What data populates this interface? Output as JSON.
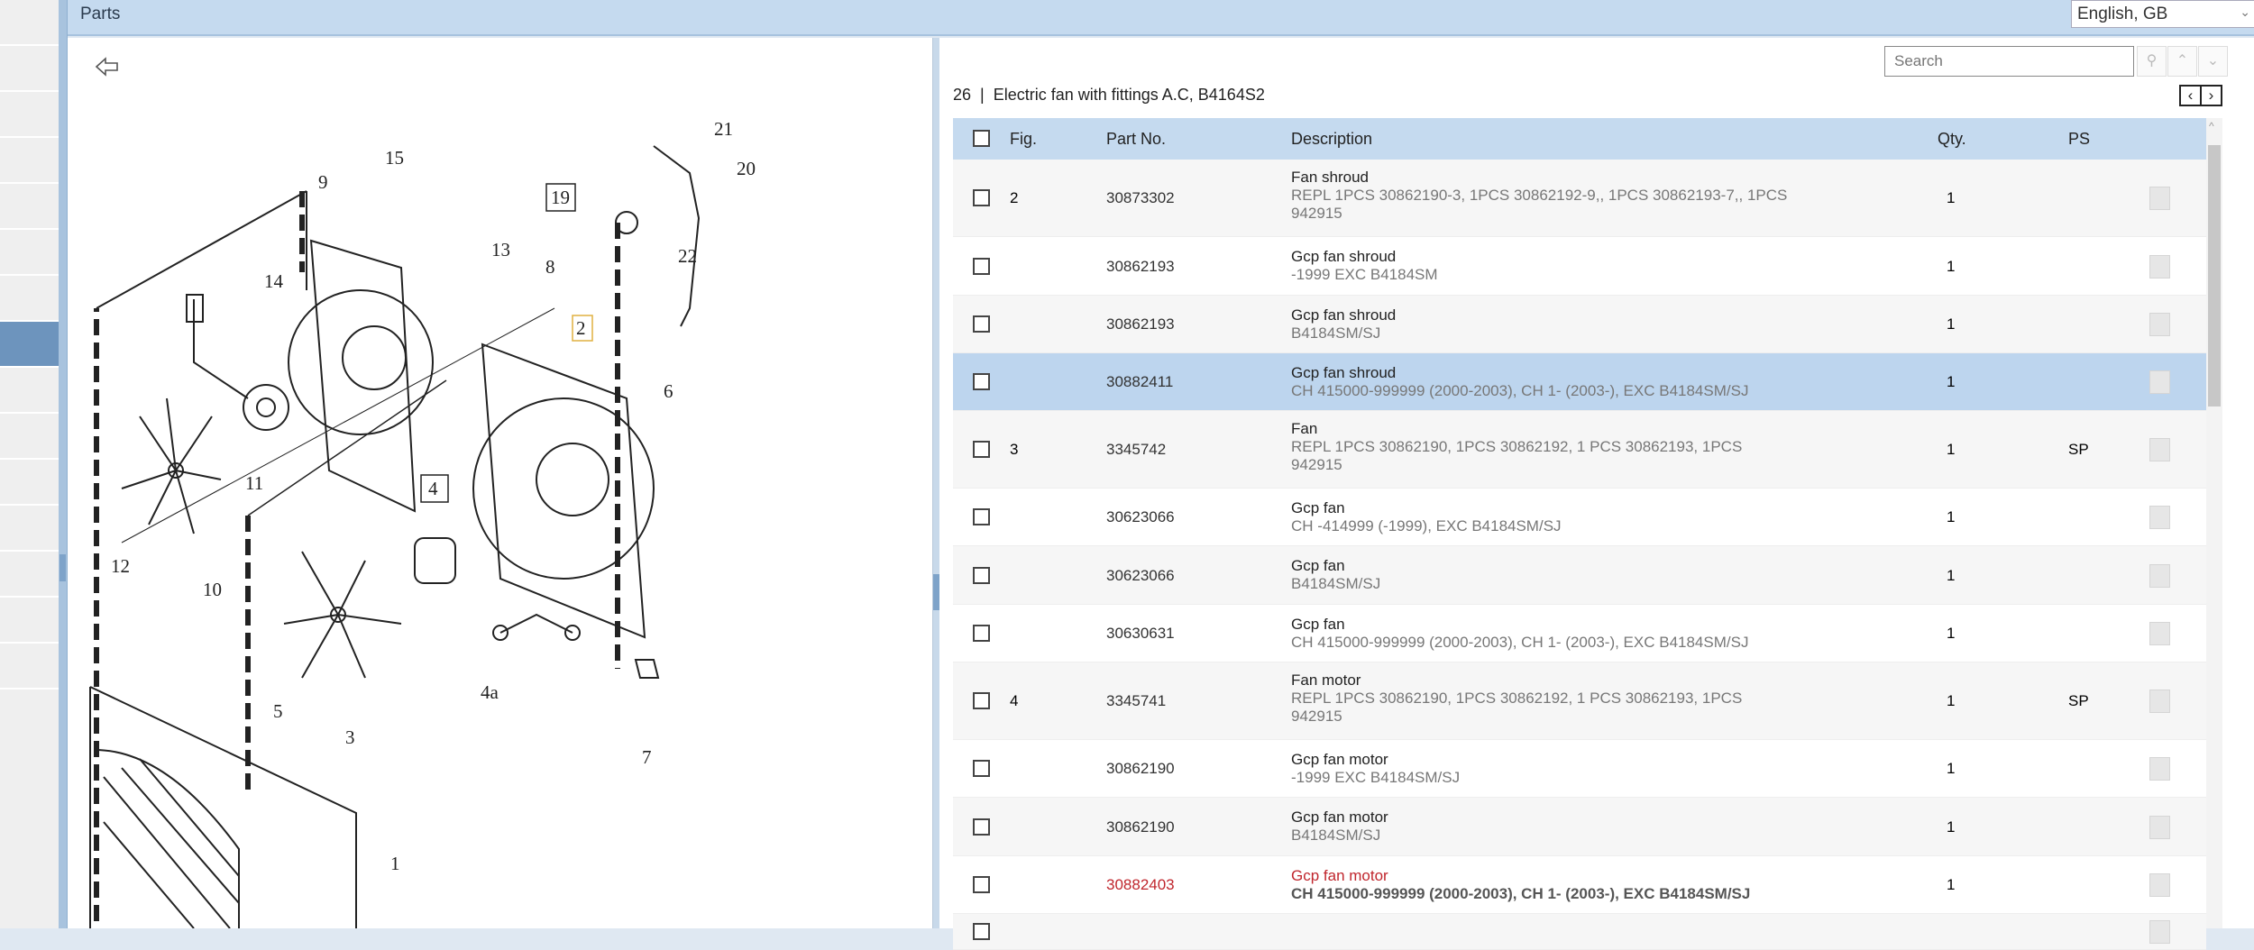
{
  "header": {
    "title": "Parts",
    "language": "English, GB"
  },
  "icons": {
    "back": "back-arrow-icon",
    "print": "printer-icon",
    "search": "search-icon"
  },
  "search": {
    "placeholder": "Search"
  },
  "panel": {
    "title": "26  |  Electric fan with fittings A.C, B4164S2",
    "prev": "‹",
    "next": "›"
  },
  "table": {
    "headers": {
      "fig": "Fig.",
      "part": "Part No.",
      "desc": "Description",
      "qty": "Qty.",
      "ps": "PS"
    },
    "rows": [
      {
        "fig": "2",
        "part": "30873302",
        "title": "Fan shroud",
        "detail": "REPL 1PCS 30862190-3, 1PCS 30862192-9,, 1PCS 30862193-7,, 1PCS 942915",
        "qty": "1",
        "ps": ""
      },
      {
        "fig": "",
        "part": "30862193",
        "title": "Gcp fan shroud",
        "detail": "-1999 EXC B4184SM",
        "qty": "1",
        "ps": ""
      },
      {
        "fig": "",
        "part": "30862193",
        "title": "Gcp fan shroud",
        "detail": "B4184SM/SJ",
        "qty": "1",
        "ps": ""
      },
      {
        "fig": "",
        "part": "30882411",
        "title": "Gcp fan shroud",
        "detail": "CH 415000-999999 (2000-2003), CH 1- (2003-), EXC B4184SM/SJ",
        "qty": "1",
        "ps": "",
        "selected": true
      },
      {
        "fig": "3",
        "part": "3345742",
        "title": "Fan",
        "detail": "REPL 1PCS 30862190, 1PCS 30862192, 1 PCS 30862193, 1PCS 942915",
        "qty": "1",
        "ps": "SP"
      },
      {
        "fig": "",
        "part": "30623066",
        "title": "Gcp fan",
        "detail": "CH -414999 (-1999), EXC B4184SM/SJ",
        "qty": "1",
        "ps": ""
      },
      {
        "fig": "",
        "part": "30623066",
        "title": "Gcp fan",
        "detail": "B4184SM/SJ",
        "qty": "1",
        "ps": ""
      },
      {
        "fig": "",
        "part": "30630631",
        "title": "Gcp fan",
        "detail": "CH 415000-999999 (2000-2003), CH 1- (2003-), EXC B4184SM/SJ",
        "qty": "1",
        "ps": ""
      },
      {
        "fig": "4",
        "part": "3345741",
        "title": "Fan motor",
        "detail": "REPL 1PCS 30862190, 1PCS 30862192, 1 PCS 30862193, 1PCS 942915",
        "qty": "1",
        "ps": "SP"
      },
      {
        "fig": "",
        "part": "30862190",
        "title": "Gcp fan motor",
        "detail": "-1999 EXC B4184SM/SJ",
        "qty": "1",
        "ps": ""
      },
      {
        "fig": "",
        "part": "30862190",
        "title": "Gcp fan motor",
        "detail": "B4184SM/SJ",
        "qty": "1",
        "ps": ""
      },
      {
        "fig": "",
        "part": "30882403",
        "title": "Gcp fan motor",
        "detail": "CH 415000-999999 (2000-2003), CH 1- (2003-), EXC B4184SM/SJ",
        "qty": "1",
        "ps": "",
        "highlight_color": "#c0262d"
      },
      {
        "fig": "",
        "part": "",
        "title": "",
        "detail": "",
        "qty": "",
        "ps": ""
      }
    ]
  },
  "diagram": {
    "labels": [
      "21",
      "20",
      "19",
      "15",
      "9",
      "13",
      "8",
      "22",
      "14",
      "2",
      "6",
      "4",
      "11",
      "12",
      "10",
      "5",
      "3",
      "4a",
      "7",
      "1"
    ]
  },
  "colors": {
    "header": "#c5daef",
    "selected_row": "#bdd5ee",
    "accent": "#6d94bd",
    "warning_text": "#c0262d"
  }
}
